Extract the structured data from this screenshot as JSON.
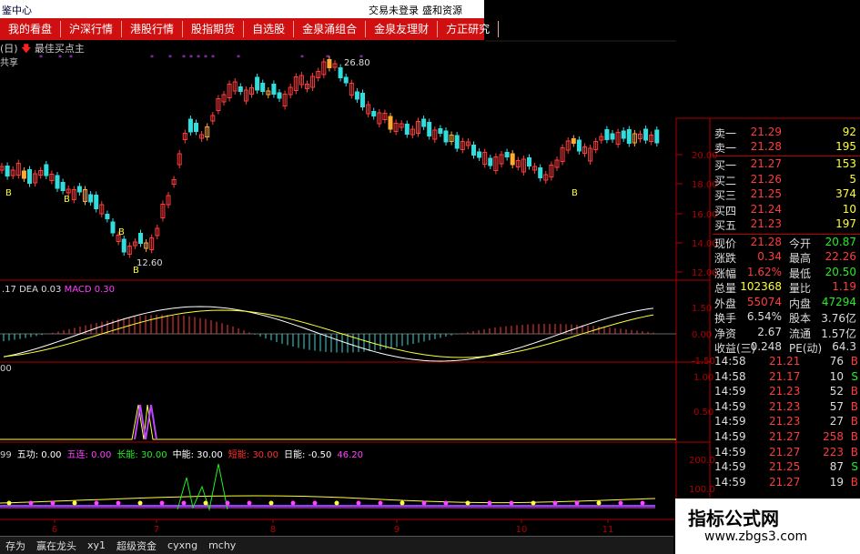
{
  "titlebar": {
    "app": "鉴中心",
    "login": "交易未登录",
    "broker": "盛和资源"
  },
  "menu": [
    "我的看盘",
    "沪深行情",
    "港股行情",
    "股指期货",
    "自选股",
    "金泉涌组合",
    "金泉友理财",
    "方正研究"
  ],
  "legend": {
    "period": "(日)",
    "indicator": "最佳买点主",
    "subtitle": "共享"
  },
  "price_labels": {
    "high": "26.80",
    "low": "12.60",
    "buy_marks": [
      "B",
      "B",
      "B",
      "B",
      "B"
    ]
  },
  "price_axis": [
    "20.00",
    "18.00",
    "16.00",
    "14.00",
    "12.00"
  ],
  "macd": {
    "dif": ".17",
    "dea_label": "DEA",
    "dea": "0.03",
    "macd_label": "MACD",
    "macd": "0.30"
  },
  "macd_axis": [
    "1.50",
    "0.00",
    "-1.50"
  ],
  "panel3": {
    "label": "00",
    "axis": [
      "1.00",
      "0.50"
    ]
  },
  "panel4": {
    "items": [
      {
        "label": "99",
        "color": "#ccc"
      },
      {
        "label": "五功: 0.00",
        "color": "#fff"
      },
      {
        "label": "五连: 0.00",
        "color": "#ff40ff"
      },
      {
        "label": "长能: 30.00",
        "color": "#22ee22"
      },
      {
        "label": "中能: 30.00",
        "color": "#fff"
      },
      {
        "label": "短能: 30.00",
        "color": "#ff3030"
      },
      {
        "label": "日能: -0.50",
        "color": "#fff"
      },
      {
        "label": "46.20",
        "color": "#ff40ff"
      }
    ],
    "axis": [
      "200.0",
      "100.0"
    ]
  },
  "x_axis": [
    "6",
    "7",
    "8",
    "9",
    "10",
    "11"
  ],
  "order_book": {
    "sell": [
      {
        "label": "卖一",
        "price": "21.29",
        "vol": "92"
      },
      {
        "label": "卖一",
        "price": "21.28",
        "vol": "195"
      }
    ],
    "buy": [
      {
        "label": "买一",
        "price": "21.27",
        "vol": "153"
      },
      {
        "label": "买二",
        "price": "21.26",
        "vol": "5"
      },
      {
        "label": "买三",
        "price": "21.25",
        "vol": "374"
      },
      {
        "label": "买四",
        "price": "21.24",
        "vol": "10"
      },
      {
        "label": "买五",
        "price": "21.23",
        "vol": "197"
      }
    ]
  },
  "quote": [
    {
      "l1": "现价",
      "v1": "21.28",
      "c1": "red",
      "l2": "今开",
      "v2": "20.87",
      "c2": "green"
    },
    {
      "l1": "涨跌",
      "v1": "0.34",
      "c1": "red",
      "l2": "最高",
      "v2": "22.26",
      "c2": "red"
    },
    {
      "l1": "涨幅",
      "v1": "1.62%",
      "c1": "red",
      "l2": "最低",
      "v2": "20.50",
      "c2": "green"
    },
    {
      "l1": "总量",
      "v1": "102368",
      "c1": "yellow",
      "l2": "量比",
      "v2": "1.19",
      "c2": "red"
    },
    {
      "l1": "外盘",
      "v1": "55074",
      "c1": "red",
      "l2": "内盘",
      "v2": "47294",
      "c2": "green"
    },
    {
      "l1": "换手",
      "v1": "6.54%",
      "c1": "white",
      "l2": "股本",
      "v2": "3.76亿",
      "c2": "white"
    },
    {
      "l1": "净资",
      "v1": "2.67",
      "c1": "white",
      "l2": "流通",
      "v2": "1.57亿",
      "c2": "white"
    },
    {
      "l1": "收益(三)",
      "v1": "0.248",
      "c1": "white",
      "l2": "PE(动)",
      "v2": "64.3",
      "c2": "white"
    }
  ],
  "ticks": [
    {
      "time": "14:58",
      "price": "21.21",
      "vol": "76",
      "side": "B"
    },
    {
      "time": "14:58",
      "price": "21.17",
      "vol": "10",
      "side": "S"
    },
    {
      "time": "14:59",
      "price": "21.23",
      "vol": "52",
      "side": "B"
    },
    {
      "time": "14:59",
      "price": "21.23",
      "vol": "57",
      "side": "B"
    },
    {
      "time": "14:59",
      "price": "21.23",
      "vol": "27",
      "side": "B"
    },
    {
      "time": "14:59",
      "price": "21.27",
      "vol": "258",
      "side": "B"
    },
    {
      "time": "14:59",
      "price": "21.27",
      "vol": "223",
      "side": "B"
    },
    {
      "time": "14:59",
      "price": "21.25",
      "vol": "87",
      "side": "S"
    },
    {
      "time": "14:59",
      "price": "21.27",
      "vol": "19",
      "side": "B"
    }
  ],
  "bottom_tabs": [
    "存为",
    "赢在龙头",
    "xy1",
    "超级资金",
    "cyxng",
    "mchy"
  ],
  "watermark": {
    "title": "指标公式网",
    "url": "www.zbgs3.com"
  },
  "colors": {
    "menu_bg": "#d01010",
    "up": "#ff3c3c",
    "down": "#33dddd",
    "grid": "#b00000"
  }
}
